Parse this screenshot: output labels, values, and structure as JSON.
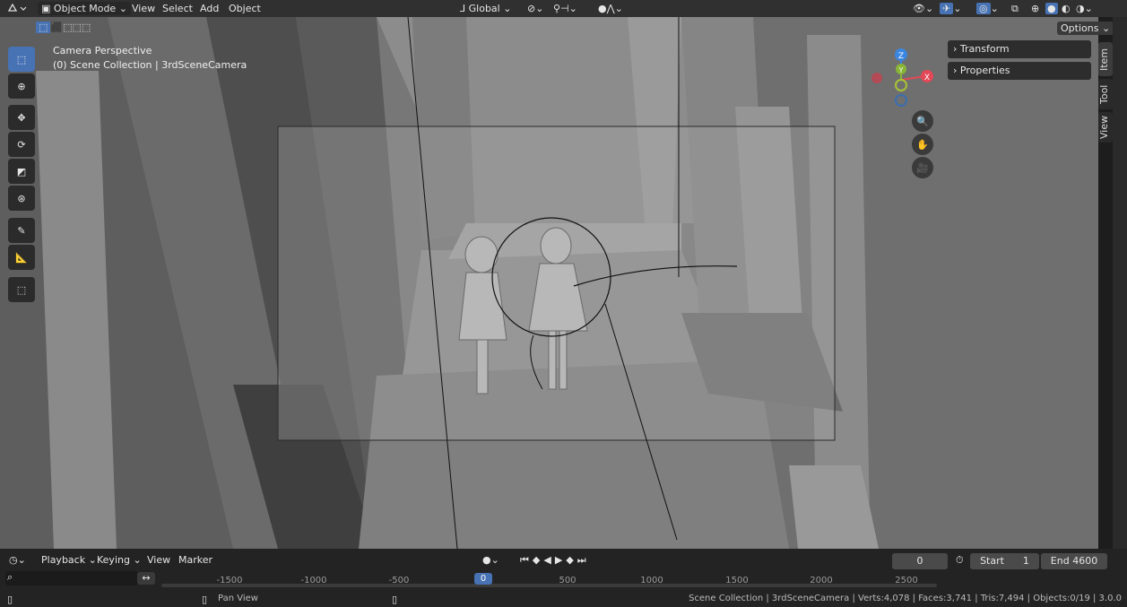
{
  "header": {
    "mode_label": "Object Mode",
    "menus": [
      "View",
      "Select",
      "Add",
      "Object"
    ],
    "transform_orientation": "Global",
    "options_label": "Options"
  },
  "viewport": {
    "camera_label": "Camera Perspective",
    "collection_label": "(0) Scene Collection | 3rdSceneCamera",
    "gizmo_axes": [
      "Z",
      "Y",
      "X"
    ],
    "npanel": [
      "Transform",
      "Properties"
    ],
    "side_tabs": [
      "Item",
      "Tool",
      "View"
    ]
  },
  "timeline": {
    "menus": [
      "Playback",
      "Keying",
      "View",
      "Marker"
    ],
    "current_frame": "0",
    "start_label": "Start",
    "start_value": "1",
    "end_label": "End",
    "end_value": "4600",
    "ticks": [
      "-1500",
      "-1000",
      "-500",
      "0",
      "500",
      "1000",
      "1500",
      "2000",
      "2500"
    ]
  },
  "statusbar": {
    "pan_label": "Pan View",
    "stats": "Scene Collection | 3rdSceneCamera | Verts:4,078 | Faces:3,741 | Tris:7,494 | Objects:0/19 | 3.0.0"
  },
  "colors": {
    "accent": "#4772b3",
    "axis_x": "#e34856",
    "axis_y": "#88b536",
    "axis_z": "#3a86e0",
    "frame_marker": "#4772b3"
  }
}
